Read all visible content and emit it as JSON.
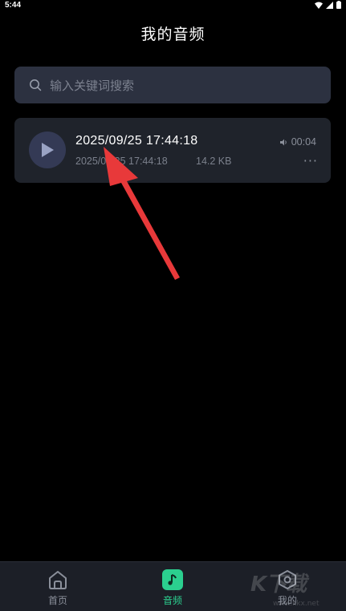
{
  "status_bar": {
    "time": "5:44"
  },
  "header": {
    "title": "我的音频"
  },
  "search": {
    "placeholder": "输入关键词搜索",
    "icon": "search-icon"
  },
  "audio_list": [
    {
      "title": "2025/09/25 17:44:18",
      "date": "2025/09/25 17:44:18",
      "size": "14.2 KB",
      "duration": "00:04"
    }
  ],
  "bottom_nav": {
    "items": [
      {
        "label": "首页",
        "icon": "home-icon",
        "active": false
      },
      {
        "label": "音频",
        "icon": "music-note-icon",
        "active": true
      },
      {
        "label": "我的",
        "icon": "profile-icon",
        "active": false
      }
    ]
  },
  "watermark": {
    "text": "K下载",
    "url": "www.kkx.net"
  },
  "colors": {
    "background": "#000000",
    "card": "#1f232b",
    "search": "#2c3140",
    "accent": "#2bcf8f",
    "annotation_arrow": "#e8393a"
  }
}
